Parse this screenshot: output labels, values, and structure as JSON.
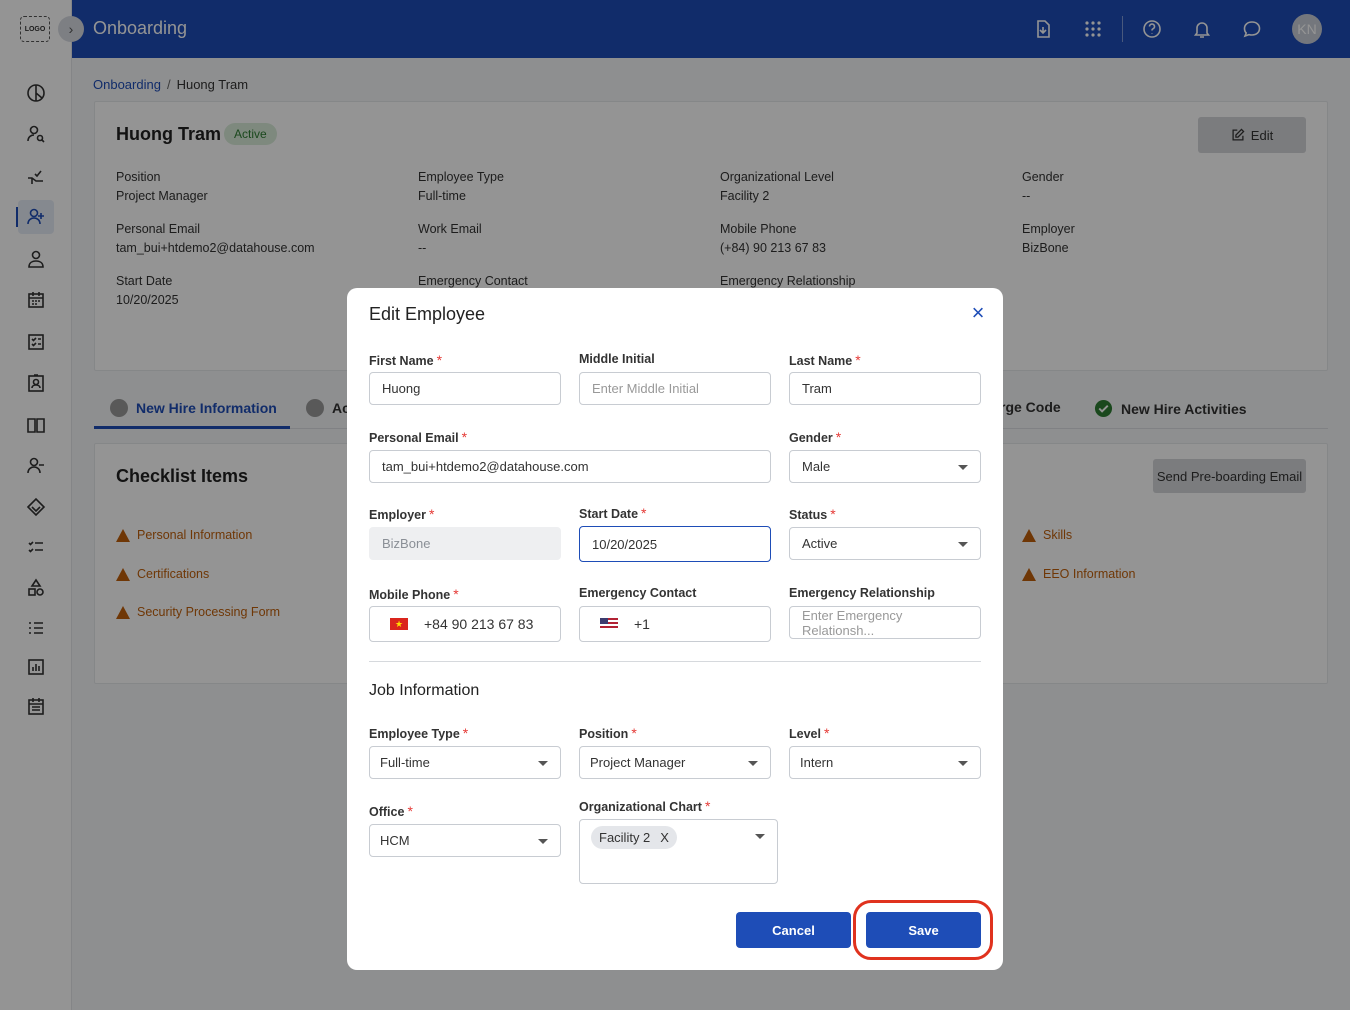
{
  "app": {
    "logo_text": "LOGO",
    "title": "Onboarding",
    "avatar_initials": "KN"
  },
  "breadcrumb": {
    "root": "Onboarding",
    "separator": "/",
    "current": "Huong Tram"
  },
  "employee": {
    "name": "Huong Tram",
    "status_badge": "Active",
    "edit_label": "Edit",
    "fields": {
      "position_label": "Position",
      "position_value": "Project Manager",
      "employee_type_label": "Employee Type",
      "employee_type_value": "Full-time",
      "org_level_label": "Organizational Level",
      "org_level_value": "Facility 2",
      "gender_label": "Gender",
      "gender_value": "--",
      "personal_email_label": "Personal Email",
      "personal_email_value": "tam_bui+htdemo2@datahouse.com",
      "work_email_label": "Work Email",
      "work_email_value": "--",
      "mobile_phone_label": "Mobile Phone",
      "mobile_phone_value": "(+84) 90 213 67 83",
      "employer_label": "Employer",
      "employer_value": "BizBone",
      "start_date_label": "Start Date",
      "start_date_value": "10/20/2025",
      "emergency_contact_label": "Emergency Contact",
      "emergency_relationship_label": "Emergency Relationship"
    }
  },
  "tabs": {
    "new_hire_information": "New Hire Information",
    "partial_second": "Ac",
    "partial_badge_code": "rge Code",
    "new_hire_activities": "New Hire Activities"
  },
  "checklist": {
    "title": "Checklist Items",
    "send_button": "Send Pre-boarding Email",
    "items": [
      "Personal Information",
      "Certifications",
      "Security Processing Form",
      "Skills",
      "EEO Information"
    ]
  },
  "modal": {
    "title": "Edit Employee",
    "close_icon": "×",
    "first_name": {
      "label": "First Name",
      "value": "Huong"
    },
    "middle_initial": {
      "label": "Middle Initial",
      "placeholder": "Enter Middle Initial"
    },
    "last_name": {
      "label": "Last Name",
      "value": "Tram"
    },
    "personal_email": {
      "label": "Personal Email",
      "value": "tam_bui+htdemo2@datahouse.com"
    },
    "gender": {
      "label": "Gender",
      "value": "Male"
    },
    "employer": {
      "label": "Employer",
      "value": "BizBone"
    },
    "start_date": {
      "label": "Start Date",
      "value": "10/20/2025"
    },
    "status": {
      "label": "Status",
      "value": "Active"
    },
    "mobile_phone": {
      "label": "Mobile Phone",
      "value": "+84 90 213 67 83"
    },
    "emergency_contact": {
      "label": "Emergency Contact",
      "value": "+1"
    },
    "emergency_relationship": {
      "label": "Emergency Relationship",
      "placeholder": "Enter Emergency Relationsh..."
    },
    "job_section_title": "Job Information",
    "employee_type": {
      "label": "Employee Type",
      "value": "Full-time"
    },
    "position": {
      "label": "Position",
      "value": "Project Manager"
    },
    "level": {
      "label": "Level",
      "value": "Intern"
    },
    "office": {
      "label": "Office",
      "value": "HCM"
    },
    "org_chart": {
      "label": "Organizational Chart",
      "chip": "Facility 2",
      "chip_remove": "X"
    },
    "required_mark": "*",
    "cancel_label": "Cancel",
    "save_label": "Save"
  },
  "colors": {
    "primary": "#1e4db7",
    "warning": "#c0600c",
    "highlight": "#e0321e",
    "active_badge": "#2e7d32"
  }
}
